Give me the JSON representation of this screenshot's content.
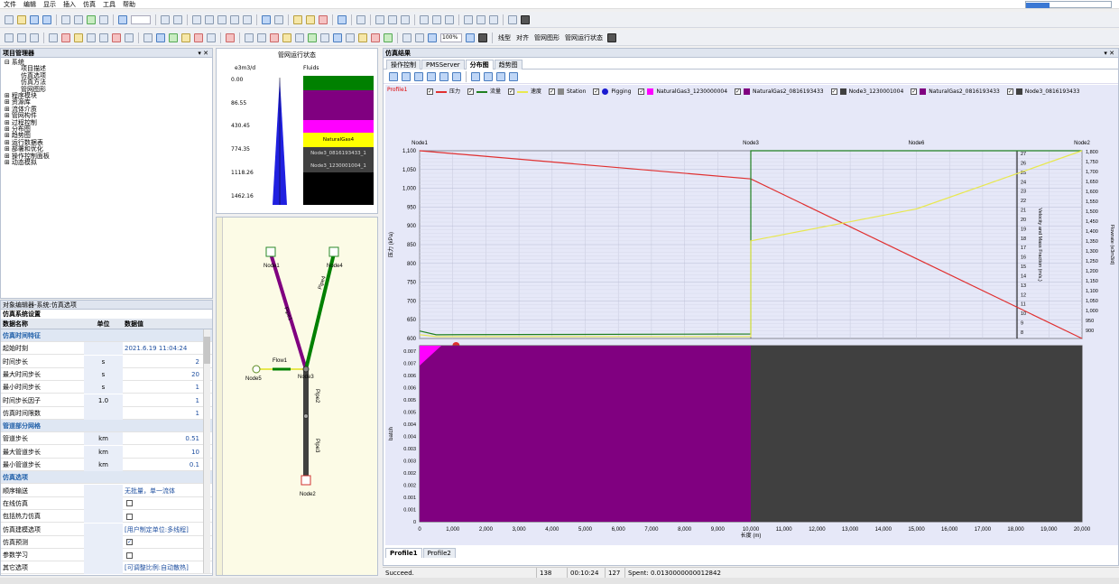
{
  "menu": [
    "文件",
    "编辑",
    "显示",
    "插入",
    "仿真",
    "工具",
    "帮助"
  ],
  "toolbar2": {
    "zoom": "100%",
    "items": [
      "线型",
      "对齐",
      "管网图形",
      "管网运行状态"
    ]
  },
  "project": {
    "title": "项目管理器",
    "items": [
      {
        "t": "系统",
        "i": 0,
        "s": "⊟"
      },
      {
        "t": "项目描述",
        "i": 2,
        "s": ""
      },
      {
        "t": "仿真选项",
        "i": 2,
        "s": ""
      },
      {
        "t": "仿真方法",
        "i": 2,
        "s": ""
      },
      {
        "t": "管网图形",
        "i": 2,
        "s": ""
      },
      {
        "t": "程序模块",
        "i": 0,
        "s": "⊞"
      },
      {
        "t": "资源库",
        "i": 0,
        "s": "⊞"
      },
      {
        "t": "流体介质",
        "i": 0,
        "s": "⊞"
      },
      {
        "t": "管网构件",
        "i": 0,
        "s": "⊞"
      },
      {
        "t": "过程控制",
        "i": 0,
        "s": "⊞"
      },
      {
        "t": "分布图",
        "i": 0,
        "s": "⊞"
      },
      {
        "t": "趋势图",
        "i": 0,
        "s": "⊞"
      },
      {
        "t": "运行数据表",
        "i": 0,
        "s": "⊞"
      },
      {
        "t": "部署和优化",
        "i": 0,
        "s": "⊞"
      },
      {
        "t": "操作控制面板",
        "i": 0,
        "s": "⊞"
      },
      {
        "t": "动态模拟",
        "i": 0,
        "s": "⊞"
      }
    ]
  },
  "objpanel": {
    "title": "对象编辑器-系统:仿真选项",
    "sub": "仿真系统设置",
    "cols": [
      "数据名称",
      "单位",
      "数据值"
    ],
    "rows": [
      {
        "cat": "仿真时间特征"
      },
      {
        "n": "起始时刻",
        "u": "",
        "v": "2021.6.19 11:04:24"
      },
      {
        "n": "时间步长",
        "u": "s",
        "v": "2"
      },
      {
        "n": "最大时间步长",
        "u": "s",
        "v": "20"
      },
      {
        "n": "最小时间步长",
        "u": "s",
        "v": "1"
      },
      {
        "n": "时间步长因子",
        "u": "1.0",
        "v": "1"
      },
      {
        "n": "仿真时间限数",
        "u": "",
        "v": "1"
      },
      {
        "cat": "管道部分网格"
      },
      {
        "n": "管道步长",
        "u": "km",
        "v": "0.51"
      },
      {
        "n": "最大管道步长",
        "u": "km",
        "v": "10"
      },
      {
        "n": "最小管道步长",
        "u": "km",
        "v": "0.1"
      },
      {
        "cat": "仿真选项"
      },
      {
        "n": "顺序输送",
        "u": "",
        "v": "无批量，单一流体"
      },
      {
        "n": "在线仿真",
        "u": "",
        "cb": ""
      },
      {
        "n": "包括热力仿真",
        "u": "",
        "cb": ""
      },
      {
        "n": "仿真建模选项",
        "u": "",
        "v": "[用户制定单位:多线程]"
      },
      {
        "n": "仿真预测",
        "u": "",
        "cb": "✓"
      },
      {
        "n": "参数学习",
        "u": "",
        "cb": ""
      },
      {
        "n": "其它选项",
        "u": "",
        "v": "[可调整比例:自动散热]"
      }
    ]
  },
  "batch": {
    "title": "管网运行状态",
    "unit": "e3m3/d",
    "fluids": "Fluids",
    "ticks": [
      "0.00",
      "86.55",
      "430.45",
      "774.35",
      "1118.26",
      "1462.16"
    ],
    "bands": [
      {
        "c": "#008000",
        "label": ""
      },
      {
        "c": "#800080",
        "label": ""
      },
      {
        "c": "#ff00ff",
        "label": ""
      },
      {
        "c": "#ffff00",
        "label": "NaturalGas4"
      },
      {
        "c": "#404040",
        "label": "Node3_0816193433_1"
      },
      {
        "c": "#404040",
        "label": "Node3_1230001004_1"
      },
      {
        "c": "#000000",
        "label": ""
      }
    ]
  },
  "network": {
    "nodes": [
      "Node1",
      "Node4",
      "Node5",
      "Node3",
      "Node2"
    ],
    "pipes": [
      "Pipe1",
      "Pipe4",
      "Flow1",
      "Pipe2",
      "Pipe3"
    ]
  },
  "result": {
    "title": "仿真结果",
    "tabs": [
      "操作控制",
      "PMSServer",
      "分布图",
      "趋势图"
    ],
    "active": 2,
    "profile": "Profile1",
    "legend": [
      "压力",
      "流量",
      "速度",
      "Station",
      "Pigging",
      "NaturalGas3_1230000004",
      "NaturalGas2_0816193433",
      "Node3_1230001004",
      "NaturalGas2_0816193433",
      "Node3_0816193433"
    ],
    "bottom_tabs": [
      "Profile1",
      "Profile2"
    ]
  },
  "chart_data": {
    "type": "line",
    "x_nodes": [
      {
        "name": "Node1",
        "x": 0
      },
      {
        "name": "Node3",
        "x": 10000
      },
      {
        "name": "Node6",
        "x": 15000
      },
      {
        "name": "Node2",
        "x": 20000
      }
    ],
    "xlabel": "长度 (m)",
    "xlim": [
      0,
      20000
    ],
    "xticks": [
      "0",
      "1,000",
      "2,000",
      "3,000",
      "4,000",
      "5,000",
      "6,000",
      "7,000",
      "8,000",
      "9,000",
      "10,000",
      "11,000",
      "12,000",
      "13,000",
      "14,000",
      "15,000",
      "16,000",
      "17,000",
      "18,000",
      "19,000",
      "20,000"
    ],
    "ylabel": "压力 (kPa)",
    "ylim": [
      600,
      1100
    ],
    "yticks": [
      "600",
      "650",
      "700",
      "750",
      "800",
      "850",
      "900",
      "950",
      "1,000",
      "1,050",
      "1,100"
    ],
    "y2label": "Velocity and Mass Fraction (m/s,)",
    "y2ticks": [
      "8",
      "9",
      "10",
      "11",
      "12",
      "13",
      "14",
      "15",
      "16",
      "17",
      "18",
      "19",
      "20",
      "21",
      "22",
      "23",
      "24",
      "25",
      "26",
      "27"
    ],
    "y3label": "Flowrate (e3m3/d)",
    "y3ticks": [
      "900",
      "950",
      "1,000",
      "1,050",
      "1,100",
      "1,150",
      "1,200",
      "1,250",
      "1,300",
      "1,350",
      "1,400",
      "1,450",
      "1,500",
      "1,550",
      "1,600",
      "1,650",
      "1,700",
      "1,750",
      "1,800"
    ],
    "series": [
      {
        "name": "压力",
        "color": "#e03030",
        "x": [
          0,
          10000,
          20000
        ],
        "y": [
          1100,
          1025,
          600
        ]
      },
      {
        "name": "流量",
        "color": "#208020",
        "x": [
          0,
          500,
          10000,
          10000,
          20000
        ],
        "y": [
          620,
          610,
          612,
          1100,
          1100
        ]
      },
      {
        "name": "速度",
        "color": "#e8e850",
        "x": [
          0,
          500,
          10000,
          10000,
          15000,
          20000
        ],
        "y": [
          610,
          605,
          605,
          860,
          945,
          1100
        ]
      }
    ],
    "batch_plot": {
      "ylabel": "batch",
      "yticks": [
        "0",
        "0.001",
        "0.001",
        "0.002",
        "0.002",
        "0.003",
        "0.003",
        "0.004",
        "0.004",
        "0.005",
        "0.005",
        "0.006",
        "0.006",
        "0.007",
        "0.007"
      ],
      "regions": [
        {
          "from": 0,
          "to": 10000,
          "c": "#800080"
        },
        {
          "from": 10000,
          "to": 20000,
          "c": "#404040"
        }
      ]
    }
  },
  "status": [
    "Succeed.",
    "138",
    "00:10:24",
    "127",
    "Spent: 0.0130000000012842"
  ]
}
